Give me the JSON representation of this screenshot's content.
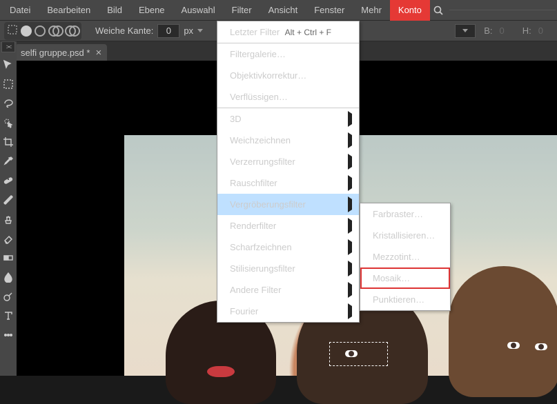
{
  "menubar": {
    "items": [
      "Datei",
      "Bearbeiten",
      "Bild",
      "Ebene",
      "Auswahl",
      "Filter",
      "Ansicht",
      "Fenster",
      "Mehr",
      "Konto"
    ],
    "highlight_index": 9
  },
  "optionsbar": {
    "feather_label": "Weiche Kante:",
    "feather_value": "0",
    "feather_unit": "px",
    "width_label": "B:",
    "width_value": "0",
    "height_label": "H:",
    "height_value": "0"
  },
  "document": {
    "tab_title": "selfi gruppe.psd *",
    "collapse_glyph": "><"
  },
  "filter_menu": {
    "top": {
      "label": "Letzter Filter",
      "shortcut": "Alt + Ctrl + F"
    },
    "group1": [
      "Filtergalerie…",
      "Objektivkorrektur…",
      "Verflüssigen…"
    ],
    "group2": [
      {
        "label": "3D",
        "sub": true
      },
      {
        "label": "Weichzeichnen",
        "sub": true
      },
      {
        "label": "Verzerrungsfilter",
        "sub": true
      },
      {
        "label": "Rauschfilter",
        "sub": true
      },
      {
        "label": "Vergröberungsfilter",
        "sub": true,
        "hover": true
      },
      {
        "label": "Renderfilter",
        "sub": true
      },
      {
        "label": "Scharfzeichnen",
        "sub": true
      },
      {
        "label": "Stilisierungsfilter",
        "sub": true
      },
      {
        "label": "Andere Filter",
        "sub": true
      },
      {
        "label": "Fourier",
        "sub": true
      }
    ]
  },
  "sub_menu": {
    "items": [
      {
        "label": "Farbraster…"
      },
      {
        "label": "Kristallisieren…"
      },
      {
        "label": "Mezzotint…"
      },
      {
        "label": "Mosaik…",
        "boxed": true
      },
      {
        "label": "Punktieren…"
      }
    ]
  },
  "tools": [
    "move",
    "marquee",
    "lasso",
    "quick-select",
    "crop",
    "eyedropper",
    "healing",
    "brush",
    "clone",
    "eraser",
    "gradient",
    "blur",
    "dodge",
    "type"
  ]
}
